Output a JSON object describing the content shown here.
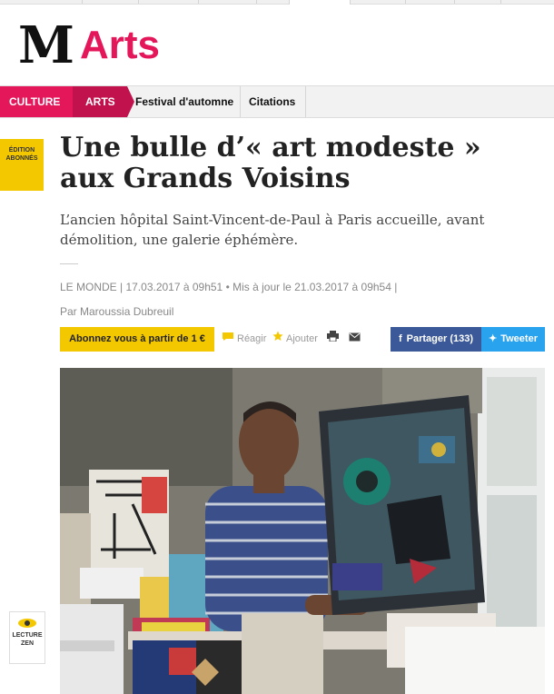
{
  "header": {
    "logo_glyph": "M",
    "section_title": "Arts"
  },
  "nav": {
    "items": [
      {
        "label": "CULTURE"
      },
      {
        "label": "ARTS"
      },
      {
        "label": "Festival d'automne"
      },
      {
        "label": "Citations"
      }
    ]
  },
  "side": {
    "badge_line1": "ÉDITION",
    "badge_line2": "ABONNÉS",
    "zen_line1": "LECTURE",
    "zen_line2": "ZEN"
  },
  "article": {
    "title": "Une bulle d’« art modeste » aux Grands Voisins",
    "lede": "L’ancien hôpital Saint-Vincent-de-Paul à Paris accueille, avant démolition, une galerie éphémère.",
    "meta": "LE MONDE | 17.03.2017 à 09h51 • Mis à jour le 21.03.2017 à 09h54 |",
    "author": "Par Maroussia Dubreuil"
  },
  "actions": {
    "subscribe": "Abonnez vous à partir de 1 €",
    "react": "Réagir",
    "add": "Ajouter",
    "share": "Partager (133)",
    "tweet": "Tweeter"
  },
  "colors": {
    "accent": "#e5175b",
    "yellow": "#f4c800",
    "facebook": "#3b5998",
    "twitter": "#2aa3ef"
  }
}
